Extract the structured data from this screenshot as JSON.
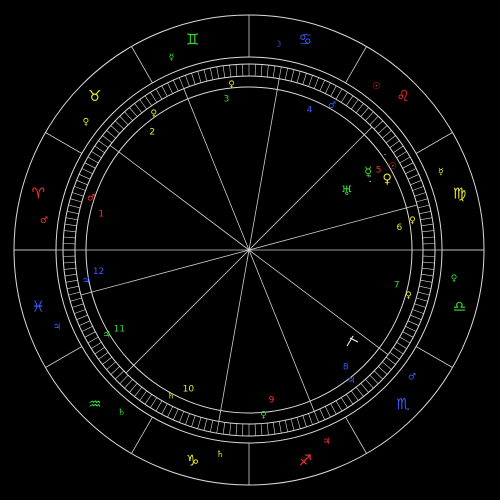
{
  "signs": [
    {
      "name": "leo",
      "glyph": "♌",
      "lon": 135,
      "color": "#ff3030"
    },
    {
      "name": "cancer",
      "glyph": "♋",
      "lon": 105,
      "color": "#3a5bff"
    },
    {
      "name": "gemini",
      "glyph": "♊",
      "lon": 75,
      "color": "#33dd33"
    },
    {
      "name": "taurus",
      "glyph": "♉",
      "lon": 45,
      "color": "#e8e830"
    },
    {
      "name": "aries",
      "glyph": "♈",
      "lon": 15,
      "color": "#ff3030"
    },
    {
      "name": "pisces",
      "glyph": "♓",
      "lon": 345,
      "color": "#3a5bff"
    },
    {
      "name": "aquarius",
      "glyph": "♒",
      "lon": 315,
      "color": "#33dd33"
    },
    {
      "name": "capricorn",
      "glyph": "♑",
      "lon": 285,
      "color": "#e8e830"
    },
    {
      "name": "sagittarius",
      "glyph": "♐",
      "lon": 255,
      "color": "#ff3030"
    },
    {
      "name": "scorpio",
      "glyph": "♏",
      "lon": 225,
      "color": "#3a5bff"
    },
    {
      "name": "libra",
      "glyph": "♎",
      "lon": 195,
      "color": "#33dd33"
    },
    {
      "name": "virgo",
      "glyph": "♍",
      "lon": 165,
      "color": "#e8e830"
    }
  ],
  "rulers": [
    {
      "name": "sun",
      "glyph": "☉",
      "lon": 135,
      "color": "#ff3030"
    },
    {
      "name": "moon",
      "glyph": "☽",
      "lon": 105,
      "color": "#3a5bff"
    },
    {
      "name": "mercury",
      "glyph": "☿",
      "lon": 75,
      "color": "#33dd33"
    },
    {
      "name": "venus",
      "glyph": "♀",
      "lon": 45,
      "color": "#e8e830"
    },
    {
      "name": "mars",
      "glyph": "♂",
      "lon": 15,
      "color": "#ff3030"
    },
    {
      "name": "jupiter",
      "glyph": "♃",
      "lon": 345,
      "color": "#3a5bff"
    },
    {
      "name": "saturn",
      "glyph": "♄",
      "lon": 315,
      "color": "#33dd33"
    },
    {
      "name": "saturn",
      "glyph": "♄",
      "lon": 285,
      "color": "#e8e830"
    },
    {
      "name": "jupiter",
      "glyph": "♃",
      "lon": 255,
      "color": "#ff3030"
    },
    {
      "name": "mars",
      "glyph": "♂",
      "lon": 225,
      "color": "#3a5bff"
    },
    {
      "name": "venus",
      "glyph": "♀",
      "lon": 195,
      "color": "#33dd33"
    },
    {
      "name": "mercury",
      "glyph": "☿",
      "lon": 165,
      "color": "#e8e830"
    }
  ],
  "houses": [
    {
      "number": "1",
      "cusp": 0,
      "color": "#ff3030"
    },
    {
      "number": "2",
      "cusp": 37,
      "color": "#e8e830"
    },
    {
      "number": "3",
      "cusp": 68,
      "color": "#33dd33"
    },
    {
      "number": "4",
      "cusp": 100,
      "color": "#3a5bff"
    },
    {
      "number": "5",
      "cusp": 135,
      "color": "#ff3030"
    },
    {
      "number": "6",
      "cusp": 165,
      "color": "#e8e830"
    },
    {
      "number": "7",
      "cusp": 180,
      "color": "#33dd33"
    },
    {
      "number": "8",
      "cusp": 217,
      "color": "#3a5bff"
    },
    {
      "number": "9",
      "cusp": 248,
      "color": "#ff3030"
    },
    {
      "number": "10",
      "cusp": 280,
      "color": "#e8e830"
    },
    {
      "number": "11",
      "cusp": 315,
      "color": "#33dd33"
    },
    {
      "number": "12",
      "cusp": 345,
      "color": "#3a5bff"
    }
  ],
  "house_rulers": [
    {
      "glyph": "♂",
      "lon": 18,
      "color": "#ff3030"
    },
    {
      "glyph": "♀",
      "lon": 55,
      "color": "#e8e830"
    },
    {
      "glyph": "♀",
      "lon": 84,
      "color": "#e8e830"
    },
    {
      "glyph": "♂",
      "lon": 120,
      "color": "#3a5bff"
    },
    {
      "glyph": "☉",
      "lon": 150,
      "color": "#ff3030"
    },
    {
      "glyph": "♀",
      "lon": 170,
      "color": "#e8e830"
    },
    {
      "glyph": "♀",
      "lon": 196,
      "color": "#e8e830"
    },
    {
      "glyph": "♃",
      "lon": 232,
      "color": "#3a5bff"
    },
    {
      "glyph": "♀",
      "lon": 265,
      "color": "#33dd33"
    },
    {
      "glyph": "♄",
      "lon": 298,
      "color": "#e8e830"
    },
    {
      "glyph": "♃",
      "lon": 329,
      "color": "#33dd33"
    },
    {
      "glyph": "♃",
      "lon": 349,
      "color": "#3a5bff"
    }
  ],
  "planets": [
    {
      "name": "venus",
      "glyph": "♀",
      "lon": 153,
      "r": 195,
      "color": "#e8e830"
    },
    {
      "name": "mercury",
      "glyph": "☿",
      "lon": 147,
      "r": 182,
      "color": "#33dd33"
    },
    {
      "name": "uranus",
      "glyph": "♅",
      "lon": 149,
      "r": 154,
      "color": "#33dd33"
    }
  ],
  "planet_markers": [
    {
      "glyph": "⁚",
      "lon": 146,
      "r": 164,
      "color": "#e8e830"
    },
    {
      "glyph": "⁚",
      "lon": 150,
      "r": 140,
      "color": "#ffffff"
    }
  ]
}
